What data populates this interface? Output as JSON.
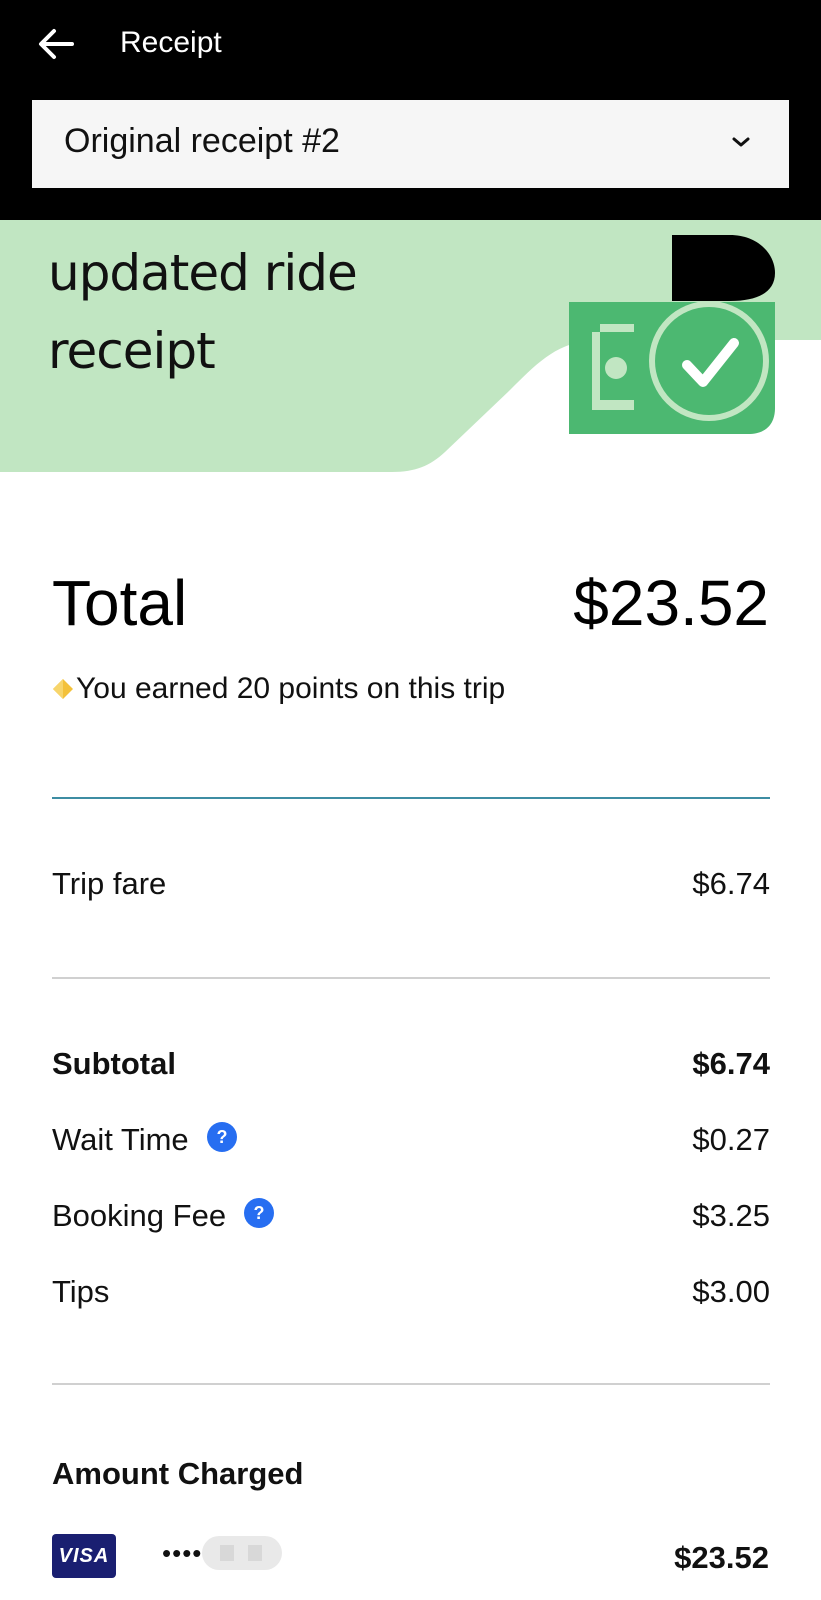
{
  "header": {
    "title": "Receipt",
    "receipt_selector_value": "Original receipt #2"
  },
  "banner": {
    "title": "updated ride receipt",
    "colors": {
      "background": "#c1e6c2",
      "money_green": "#4cb871"
    }
  },
  "summary": {
    "total_label": "Total",
    "total_amount": "$23.52",
    "points_text": "You earned 20 points on this trip"
  },
  "fare": {
    "trip_fare_label": "Trip fare",
    "trip_fare_amount": "$6.74"
  },
  "breakdown": {
    "subtotal_label": "Subtotal",
    "subtotal_amount": "$6.74",
    "items": [
      {
        "label": "Wait Time",
        "amount": "$0.27",
        "has_help": true
      },
      {
        "label": "Booking Fee",
        "amount": "$3.25",
        "has_help": true
      },
      {
        "label": "Tips",
        "amount": "$3.00",
        "has_help": false
      }
    ]
  },
  "payment": {
    "title": "Amount Charged",
    "card_brand": "VISA",
    "card_mask": "••••",
    "amount": "$23.52"
  },
  "icons": [
    "back-arrow-icon",
    "chevron-down-icon",
    "points-gem-icon",
    "help-icon",
    "money-check-illustration"
  ]
}
